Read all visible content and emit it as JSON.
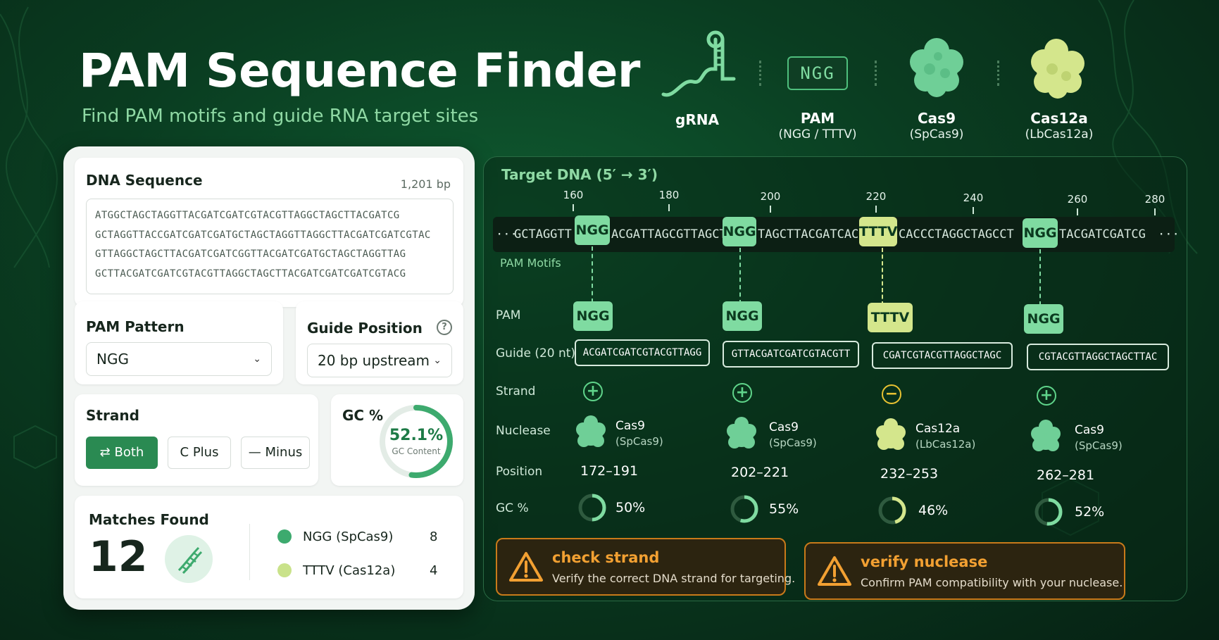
{
  "app": {
    "title": "PAM Sequence Finder",
    "subtitle": "Find PAM motifs and guide RNA target sites"
  },
  "legend": [
    {
      "label": "gRNA",
      "sub": "",
      "icon": "grna-hairpin-icon"
    },
    {
      "label": "PAM",
      "sub": "(NGG / TTTV)",
      "badge": "NGG",
      "icon": "pam-badge-icon"
    },
    {
      "label": "Cas9",
      "sub": "(SpCas9)",
      "icon": "cas9-protein-icon",
      "color": "#6fcf97"
    },
    {
      "label": "Cas12a",
      "sub": "(LbCas12a)",
      "icon": "cas12a-protein-icon",
      "color": "#d4e68c"
    }
  ],
  "left_panel": {
    "dna_sequence": {
      "title": "DNA Sequence",
      "length": "1,201 bp",
      "lines": [
        "ATGGCTAGCTAGGTTACGATCGATCGTACGTTAGGCTAGCTTACGATCG",
        "GCTAGGTTACCGATCGATCGATGCTAGCTAGGTTAGGCTTACGATCGATCGTAC",
        "GTTAGGCTAGCTTACGATCGATCGGTTACGATCGATGCTAGCTAGGTTAG",
        "GCTTACGATCGATCGTACGTTAGGCTAGCTTACGATCGATCGATCGTACG"
      ]
    },
    "pam_pattern": {
      "title": "PAM Pattern",
      "value": "NGG"
    },
    "guide_position": {
      "title": "Guide Position",
      "value": "20 bp upstream",
      "help_icon": "question-circle-icon"
    },
    "strand": {
      "title": "Strand",
      "options": [
        {
          "label": "Both",
          "icon": "⇄",
          "active": true
        },
        {
          "label": "Plus",
          "icon": "C",
          "active": false
        },
        {
          "label": "Minus",
          "icon": "—",
          "active": false
        }
      ]
    },
    "gc": {
      "title": "GC %",
      "value": "52.1%",
      "caption": "GC Content",
      "fraction": 0.521
    },
    "matches": {
      "title": "Matches Found",
      "count": "12",
      "icon": "dna-helix-icon",
      "breakdown": [
        {
          "label": "NGG (SpCas9)",
          "count": "8",
          "color": "#3daa6e"
        },
        {
          "label": "TTTV (Cas12a)",
          "count": "4",
          "color": "#c9e28a"
        }
      ]
    }
  },
  "right_panel": {
    "title": "Target DNA (5′ → 3′)",
    "ticks": [
      "160",
      "180",
      "200",
      "220",
      "240",
      "260",
      "280"
    ],
    "ellipsis": "···",
    "sequence_segments": [
      {
        "text": "GCTAGGTT"
      },
      {
        "text": "ACGATTAGCGTTAGCT"
      },
      {
        "text": "TAGCTTACGATCAC"
      },
      {
        "text": "CACCCTAGGCTAGCCT"
      },
      {
        "text": "TACGATCGATCG"
      }
    ],
    "pam_motifs_label": "PAM Motifs",
    "row_labels": {
      "pam": "PAM",
      "guide": "Guide (20 nt)",
      "strand": "Strand",
      "nuclease": "Nuclease",
      "position": "Position",
      "gc": "GC %"
    },
    "sites": [
      {
        "pam": "NGG",
        "kind": "ngg",
        "guide": "ACGATCGATCGTACGTTAGG",
        "strand": "+",
        "nuclease": "Cas9",
        "nuclease_sub": "(SpCas9)",
        "position": "172–191",
        "gc": "50%",
        "gc_fraction": 0.5
      },
      {
        "pam": "NGG",
        "kind": "ngg",
        "guide": "GTTACGATCGATCGTACGTT",
        "strand": "+",
        "nuclease": "Cas9",
        "nuclease_sub": "(SpCas9)",
        "position": "202–221",
        "gc": "55%",
        "gc_fraction": 0.55
      },
      {
        "pam": "TTTV",
        "kind": "tttv",
        "guide": "CGATCGTACGTTAGGCTAGC",
        "strand": "−",
        "nuclease": "Cas12a",
        "nuclease_sub": "(LbCas12a)",
        "position": "232–253",
        "gc": "46%",
        "gc_fraction": 0.46
      },
      {
        "pam": "NGG",
        "kind": "ngg",
        "guide": "CGTACGTTAGGCTAGCTTAC",
        "strand": "+",
        "nuclease": "Cas9",
        "nuclease_sub": "(SpCas9)",
        "position": "262–281",
        "gc": "52%",
        "gc_fraction": 0.52
      }
    ],
    "warnings": [
      {
        "title": "check strand",
        "text": "Verify the correct DNA strand for targeting.",
        "icon": "warning-triangle-icon"
      },
      {
        "title": "verify nuclease",
        "text": "Confirm PAM compatibility with your nuclease.",
        "icon": "warning-triangle-icon"
      }
    ]
  },
  "colors": {
    "ngg": "#7fdba1",
    "tttv": "#d4e68c",
    "accent": "#2a8a52",
    "warning": "#f2a032"
  }
}
